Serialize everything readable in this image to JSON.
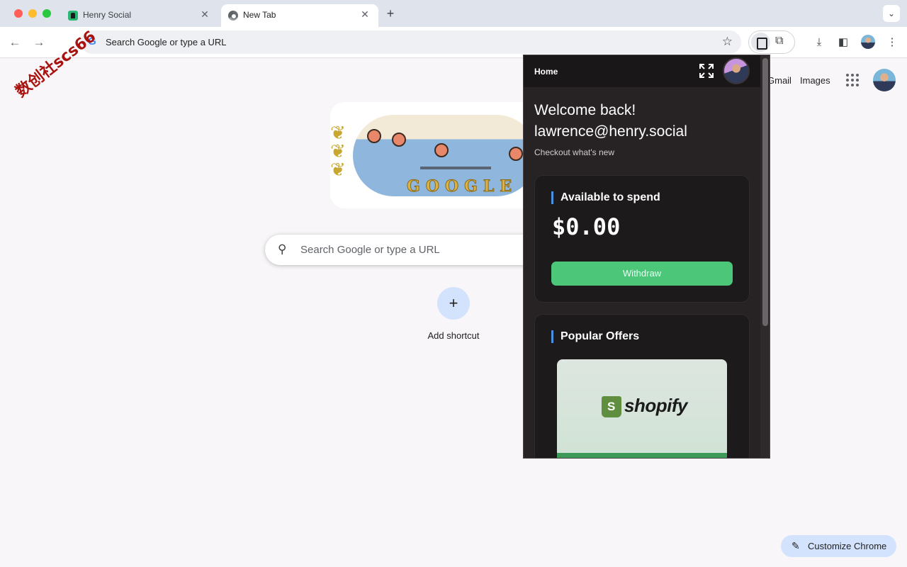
{
  "tabs": [
    {
      "title": "Henry Social",
      "close": "✕"
    },
    {
      "title": "New Tab",
      "close": "✕"
    }
  ],
  "new_tab_symbol": "+",
  "tab_search_symbol": "⌄",
  "toolbar": {
    "back": "←",
    "forward": "→",
    "omnibox_text": "Search Google or type a URL",
    "google_g": "G",
    "star": "☆",
    "puzzle": "⧉",
    "download": "⤓",
    "side_panel": "◧",
    "menu": "⋮"
  },
  "ntp": {
    "gmail": "Gmail",
    "images": "Images",
    "doodle_text": "GOOGLE",
    "search_placeholder": "Search Google or type a URL",
    "search_icon": "⚲",
    "add_symbol": "+",
    "add_shortcut": "Add shortcut",
    "customize_label": "Customize Chrome",
    "pencil": "✎"
  },
  "watermark": "数创社scs66",
  "popup": {
    "header_title": "Home",
    "welcome_line1": "Welcome back!",
    "welcome_line2": "lawrence@henry.social",
    "subtitle": "Checkout what's new",
    "balance_heading": "Available to spend",
    "balance_amount": "$0.00",
    "withdraw_label": "Withdraw",
    "offers_heading": "Popular Offers",
    "offer_brand": "shopify"
  },
  "colors": {
    "accent_green": "#4cc77a",
    "heading_bar_blue": "#4a90e2",
    "popup_bg": "#272224"
  }
}
